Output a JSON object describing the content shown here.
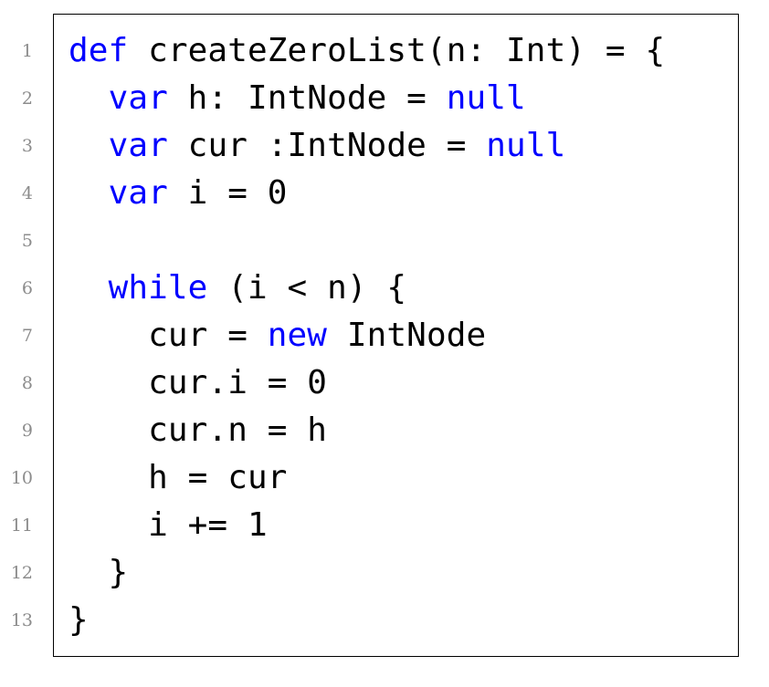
{
  "code": {
    "lines": [
      {
        "number": "1",
        "tokens": [
          {
            "text": "def",
            "kw": true
          },
          {
            "text": " createZeroList(n: Int) = {"
          }
        ]
      },
      {
        "number": "2",
        "tokens": [
          {
            "text": "  "
          },
          {
            "text": "var",
            "kw": true
          },
          {
            "text": " h: IntNode = "
          },
          {
            "text": "null",
            "kw": true
          }
        ]
      },
      {
        "number": "3",
        "tokens": [
          {
            "text": "  "
          },
          {
            "text": "var",
            "kw": true
          },
          {
            "text": " cur :IntNode = "
          },
          {
            "text": "null",
            "kw": true
          }
        ]
      },
      {
        "number": "4",
        "tokens": [
          {
            "text": "  "
          },
          {
            "text": "var",
            "kw": true
          },
          {
            "text": " i = 0"
          }
        ]
      },
      {
        "number": "5",
        "tokens": []
      },
      {
        "number": "6",
        "tokens": [
          {
            "text": "  "
          },
          {
            "text": "while",
            "kw": true
          },
          {
            "text": " (i < n) {"
          }
        ]
      },
      {
        "number": "7",
        "tokens": [
          {
            "text": "    cur = "
          },
          {
            "text": "new",
            "kw": true
          },
          {
            "text": " IntNode"
          }
        ]
      },
      {
        "number": "8",
        "tokens": [
          {
            "text": "    cur.i = 0"
          }
        ]
      },
      {
        "number": "9",
        "tokens": [
          {
            "text": "    cur.n = h"
          }
        ]
      },
      {
        "number": "10",
        "tokens": [
          {
            "text": "    h = cur"
          }
        ]
      },
      {
        "number": "11",
        "tokens": [
          {
            "text": "    i += 1"
          }
        ]
      },
      {
        "number": "12",
        "tokens": [
          {
            "text": "  }"
          }
        ]
      },
      {
        "number": "13",
        "tokens": [
          {
            "text": "}"
          }
        ]
      }
    ],
    "colors": {
      "keyword": "#0000ff",
      "text": "#000000",
      "line_number": "#8c8c8c",
      "border": "#000000"
    }
  }
}
